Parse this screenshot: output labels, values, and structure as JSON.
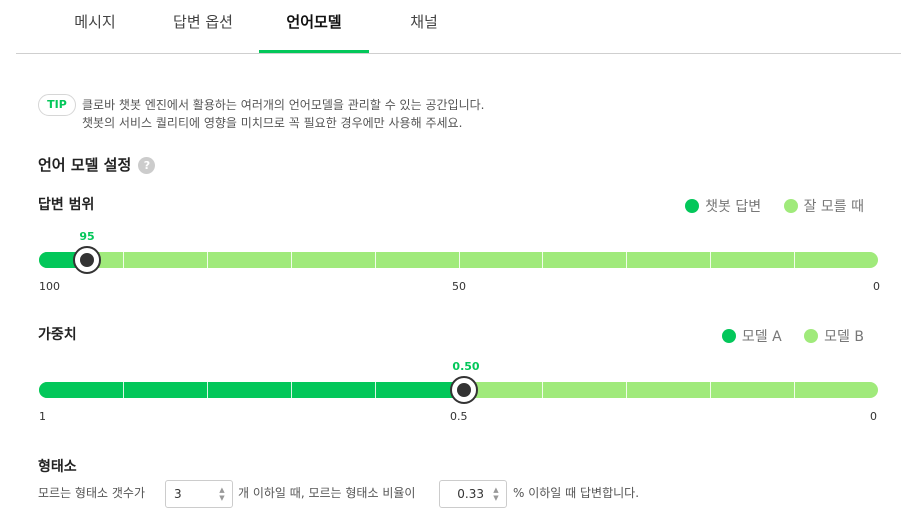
{
  "tabs": {
    "messages": "메시지",
    "reply_options": "답변 옵션",
    "language_model": "언어모델",
    "channel": "채널"
  },
  "tip": {
    "badge": "TIP",
    "line1": "클로바 챗봇 엔진에서 활용하는 여러개의 언어모델을 관리할 수 있는 공간입니다.",
    "line2": "챗봇의 서비스 퀄리티에 영향을 미치므로 꼭 필요한 경우에만 사용해 주세요."
  },
  "settings": {
    "title": "언어 모델 설정",
    "help_glyph": "?"
  },
  "answer_range": {
    "label": "답변 범위",
    "legend": [
      "챗봇 답변",
      "잘 모를 때"
    ],
    "value_label": "95",
    "value": 95,
    "scale": [
      "100",
      "50",
      "0"
    ]
  },
  "weight": {
    "label": "가중치",
    "legend": [
      "모델 A",
      "모델 B"
    ],
    "value_label": "0.50",
    "value": 0.5,
    "scale": [
      "1",
      "0.5",
      "0"
    ]
  },
  "morpheme": {
    "title": "형태소",
    "text_before": "모르는 형태소 갯수가",
    "count_value": "3",
    "text_middle": "개 이하일 때, 모르는 형태소 비율이",
    "ratio_value": "0.33",
    "text_after": "% 이하일 때 답변합니다."
  },
  "colors": {
    "accent": "#03c75a",
    "light_green": "#a0ea7b"
  },
  "icons": {
    "help": "question-circle-icon",
    "stepper": "up-down-arrows-icon"
  }
}
